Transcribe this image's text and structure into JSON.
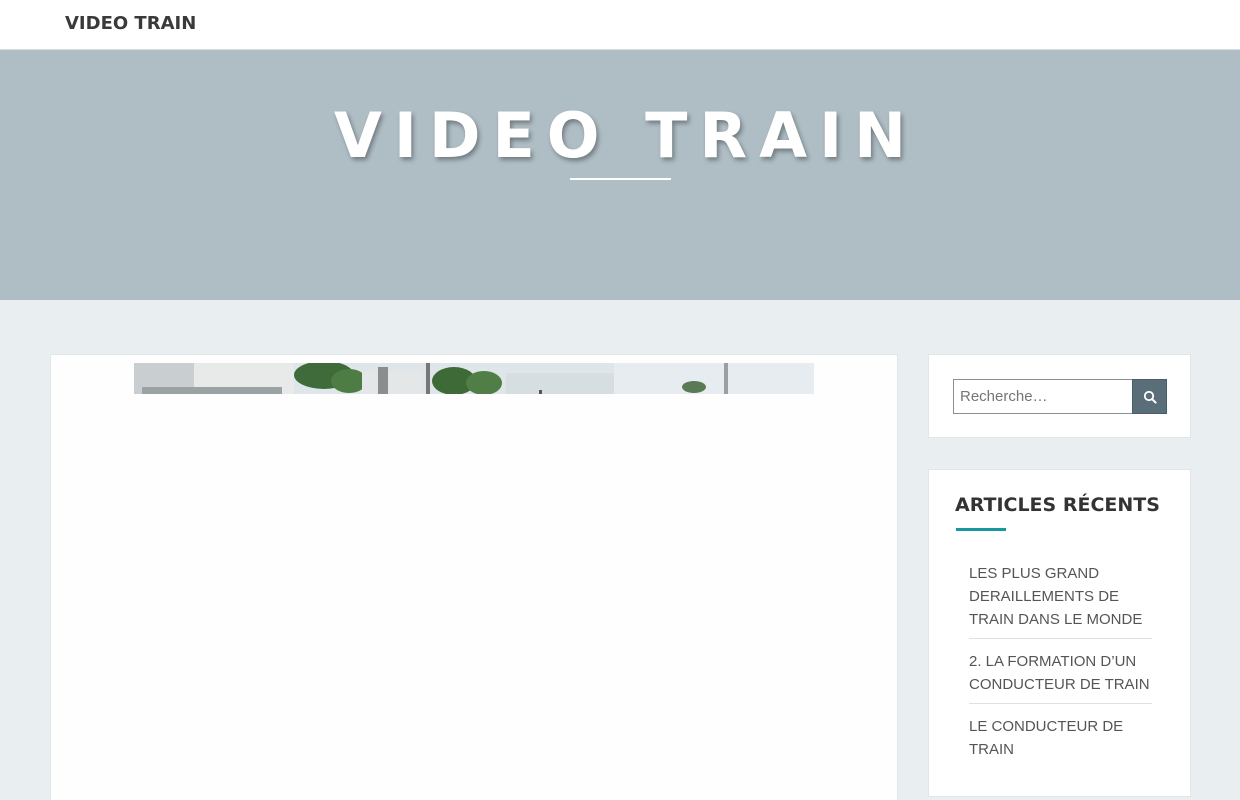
{
  "header": {
    "site_brand": "VIDEO TRAIN"
  },
  "hero": {
    "title": "VIDEO TRAIN"
  },
  "search": {
    "placeholder": "Recherche…",
    "icon": "search-icon"
  },
  "recent_posts": {
    "title": "ARTICLES RÉCENTS",
    "items": [
      {
        "label": "LES PLUS GRAND DERAILLEMENTS DE TRAIN DANS LE MONDE"
      },
      {
        "label": "2. LA FORMATION D’UN CONDUCTEUR DE TRAIN"
      },
      {
        "label": "LE CONDUCTEUR DE TRAIN"
      }
    ]
  },
  "colors": {
    "hero_bg": "#afbec5",
    "page_bg": "#e9eef0",
    "accent": "#18989e",
    "search_button": "#5a6e79"
  }
}
